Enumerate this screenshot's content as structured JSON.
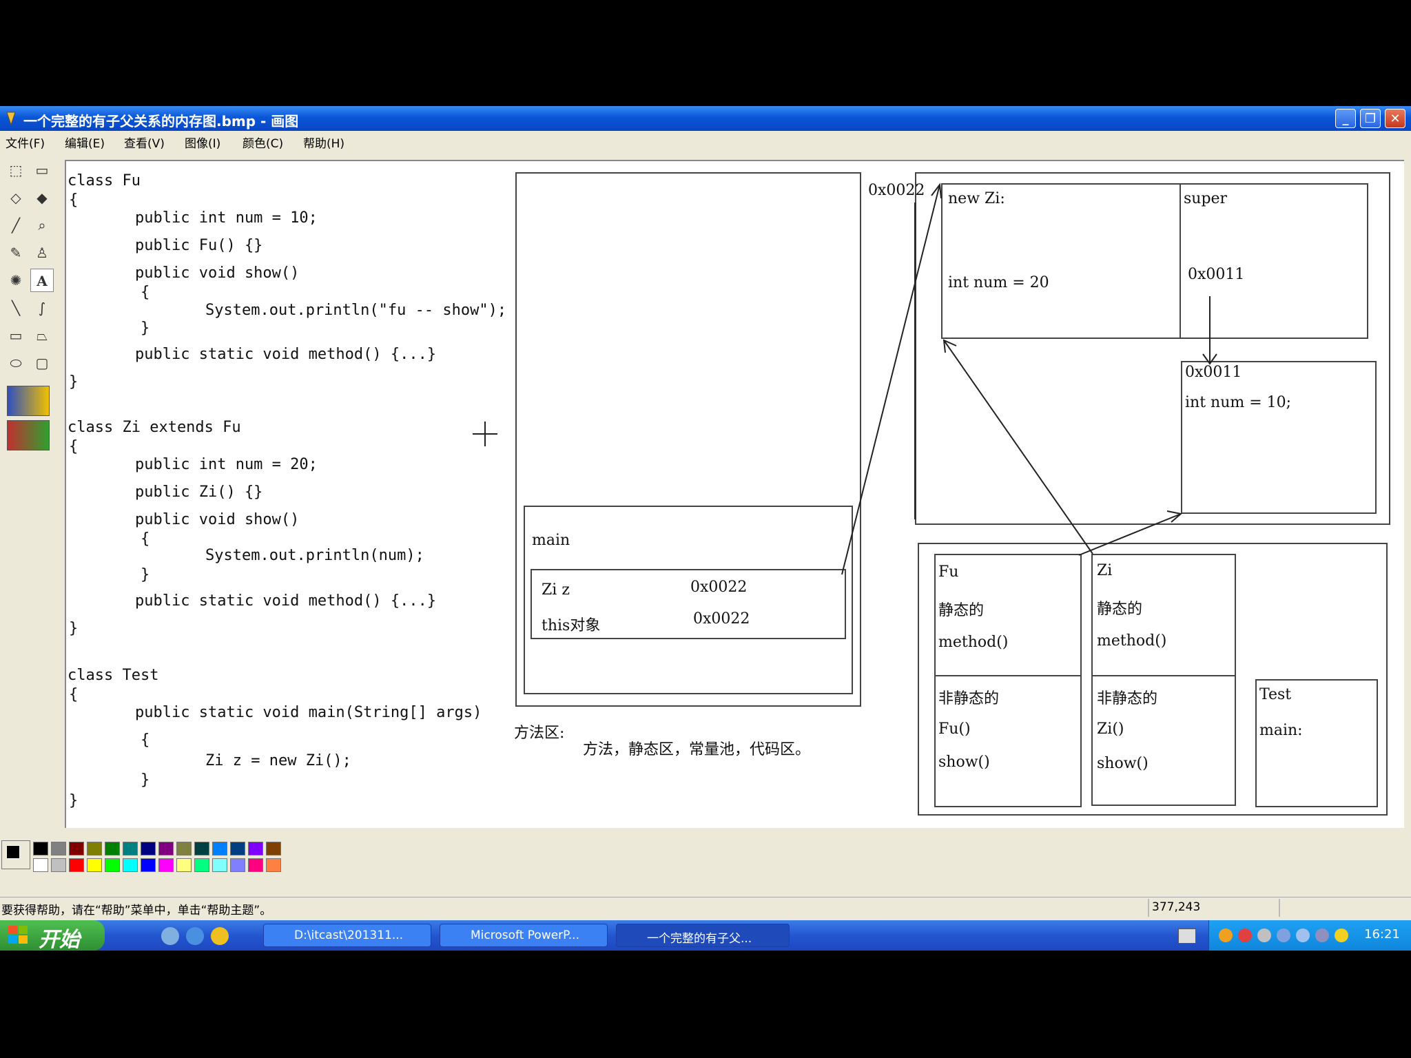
{
  "window": {
    "title": "一个完整的有子父关系的内存图.bmp - 画图"
  },
  "menu": [
    "文件(F)",
    "编辑(E)",
    "查看(V)",
    "图像(I)",
    "颜色(C)",
    "帮助(H)"
  ],
  "code": [
    "class Fu",
    "{",
    "public int num  = 10;",
    "public Fu() {}",
    "public void show()",
    "{",
    "System.out.println(\"fu -- show\");",
    "}",
    "public static void method() {...}",
    "}",
    "class Zi extends Fu",
    "{",
    "public int num = 20;",
    "public Zi() {}",
    "public void show()",
    "{",
    "System.out.println(num);",
    "}",
    "public static void method() {...}",
    "}",
    "class Test",
    "{",
    "public static void main(String[] args)",
    "{",
    "Zi z = new Zi();",
    "}",
    "}"
  ],
  "diagram": {
    "stack_main": "main",
    "stack_var_z": "Zi z",
    "stack_val_z": "0x0022",
    "stack_var_this": "this对象",
    "stack_val_this": "0x0022",
    "heap_addr": "0x0022",
    "new_zi": "new Zi:",
    "zi_num": "int num = 20",
    "super": "super",
    "super_addr": "0x0011",
    "fu_addr": "0x0011",
    "fu_num": "int num = 10;",
    "method_area_title": "方法区:",
    "method_area_desc": "方法，静态区，常量池，代码区。",
    "fu_class": "Fu",
    "fu_static": "静态的",
    "fu_method": "method()",
    "fu_nonstatic": "非静态的",
    "fu_ctor": "Fu()",
    "fu_show": "show()",
    "zi_class": "Zi",
    "zi_static": "静态的",
    "zi_method": "method()",
    "zi_nonstatic": "非静态的",
    "zi_ctor": "Zi()",
    "zi_show": "show()",
    "test_class": "Test",
    "test_main": "main:"
  },
  "palette": [
    "#000000",
    "#808080",
    "#800000",
    "#808000",
    "#008000",
    "#008080",
    "#000080",
    "#800080",
    "#808040",
    "#004040",
    "#0080ff",
    "#004080",
    "#8000ff",
    "#804000",
    "#ffffff",
    "#c0c0c0",
    "#ff0000",
    "#ffff00",
    "#00ff00",
    "#00ffff",
    "#0000ff",
    "#ff00ff",
    "#ffff80",
    "#00ff80",
    "#80ffff",
    "#8080ff",
    "#ff0080",
    "#ff8040"
  ],
  "status": {
    "help": "要获得帮助，请在“帮助”菜单中，单击“帮助主题”。",
    "coords": "377,243"
  },
  "taskbar": {
    "start": "开始",
    "tasks": [
      "D:\\itcast\\201311...",
      "Microsoft PowerP...",
      "一个完整的有子父..."
    ],
    "clock": "16:21"
  }
}
